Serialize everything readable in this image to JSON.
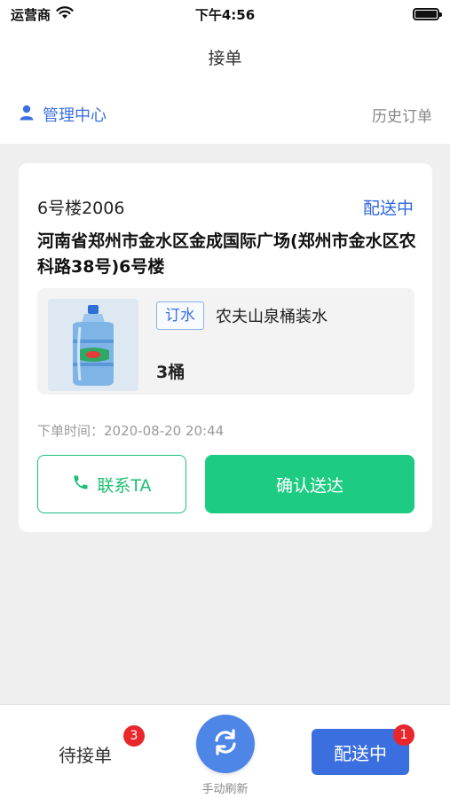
{
  "status_bar": {
    "carrier": "运营商",
    "time": "下午4:56"
  },
  "nav": {
    "title": "接单"
  },
  "sub_header": {
    "manage_label": "管理中心",
    "history_label": "历史订单"
  },
  "order": {
    "room": "6号楼2006",
    "status": "配送中",
    "address": "河南省郑州市金水区金成国际广场(郑州市金水区农科路38号)6号楼",
    "item": {
      "tag": "订水",
      "name": "农夫山泉桶装水",
      "quantity": "3桶"
    },
    "order_time_label": "下单时间：",
    "order_time": "2020-08-20 20:44",
    "contact_label": "联系TA",
    "confirm_label": "确认送达"
  },
  "tab_bar": {
    "pending_label": "待接单",
    "pending_badge": "3",
    "refresh_label": "手动刷新",
    "delivering_label": "配送中",
    "delivering_badge": "1"
  },
  "colors": {
    "accent_blue": "#3b6fe0",
    "accent_green": "#1dcc82",
    "badge_red": "#e8262b"
  }
}
